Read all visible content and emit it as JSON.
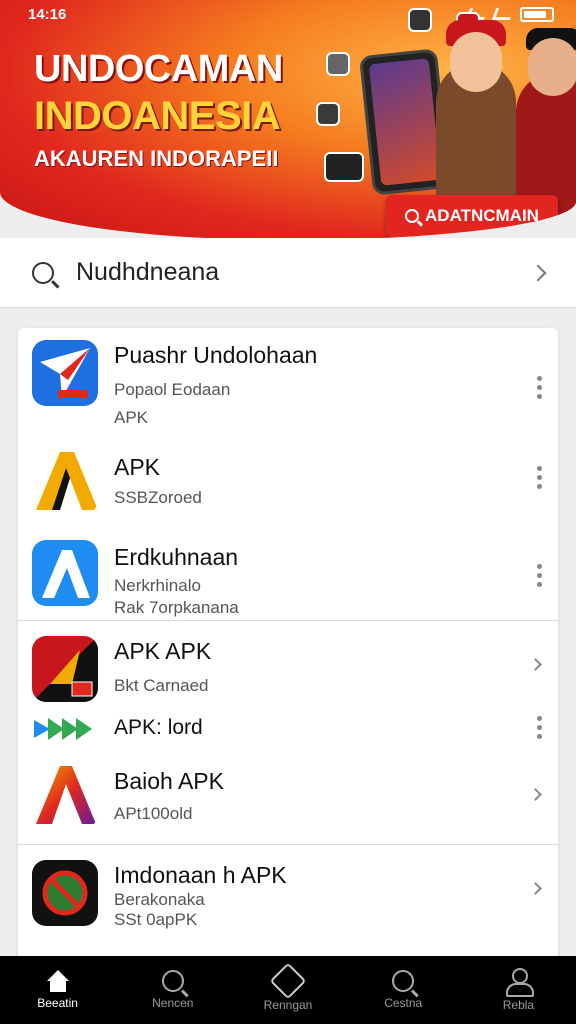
{
  "status_bar": {
    "time": "14:16"
  },
  "banner": {
    "title_line1": "UNDOCAMAN",
    "title_line2": "INDOANESIA",
    "subtitle": "AKAUREN INDORAPEII",
    "button_label": "ADATNCMAIN",
    "colors": {
      "primary": "#e3251f",
      "accent": "#ffd43b"
    }
  },
  "search": {
    "value": "Nudhdneana"
  },
  "apps": [
    {
      "title": "Puashr Undolohaan",
      "subtitle1": "Popaol Eodaan",
      "subtitle2": "APK",
      "icon": "paper-plane-icon",
      "action": "more"
    },
    {
      "title": "APK",
      "subtitle1": "SSBZoroed",
      "subtitle2": "",
      "icon": "letter-a-yellow-icon",
      "action": "more"
    },
    {
      "title": "Erdkuhnaan",
      "subtitle1": "Nerkrhinalo",
      "subtitle2": "Rak 7orpkanana",
      "icon": "letter-a-blue-icon",
      "action": "more"
    },
    {
      "title": "APK APK",
      "subtitle1": "Bkt Carnaed",
      "subtitle2": "",
      "icon": "red-black-app-icon",
      "action": "arrow"
    },
    {
      "title": "APK: lord",
      "subtitle1": "",
      "subtitle2": "",
      "icon": "play-store-icon",
      "action": "more"
    },
    {
      "title": "Baioh APK",
      "subtitle1": "APt100old",
      "subtitle2": "",
      "icon": "letter-a-gradient-icon",
      "action": "arrow"
    },
    {
      "title": "Imdonaan h APK",
      "subtitle1": "Berakonaka",
      "subtitle2": "SSt 0apPK",
      "icon": "blocked-app-icon",
      "action": "arrow"
    }
  ],
  "bottom_nav": [
    {
      "label": "Beeatin",
      "icon": "home-icon",
      "active": true
    },
    {
      "label": "Nencen",
      "icon": "search-icon",
      "active": false
    },
    {
      "label": "Renngan",
      "icon": "bag-icon",
      "active": false
    },
    {
      "label": "Cestna",
      "icon": "search-icon",
      "active": false
    },
    {
      "label": "Rebla",
      "icon": "user-icon",
      "active": false
    }
  ]
}
